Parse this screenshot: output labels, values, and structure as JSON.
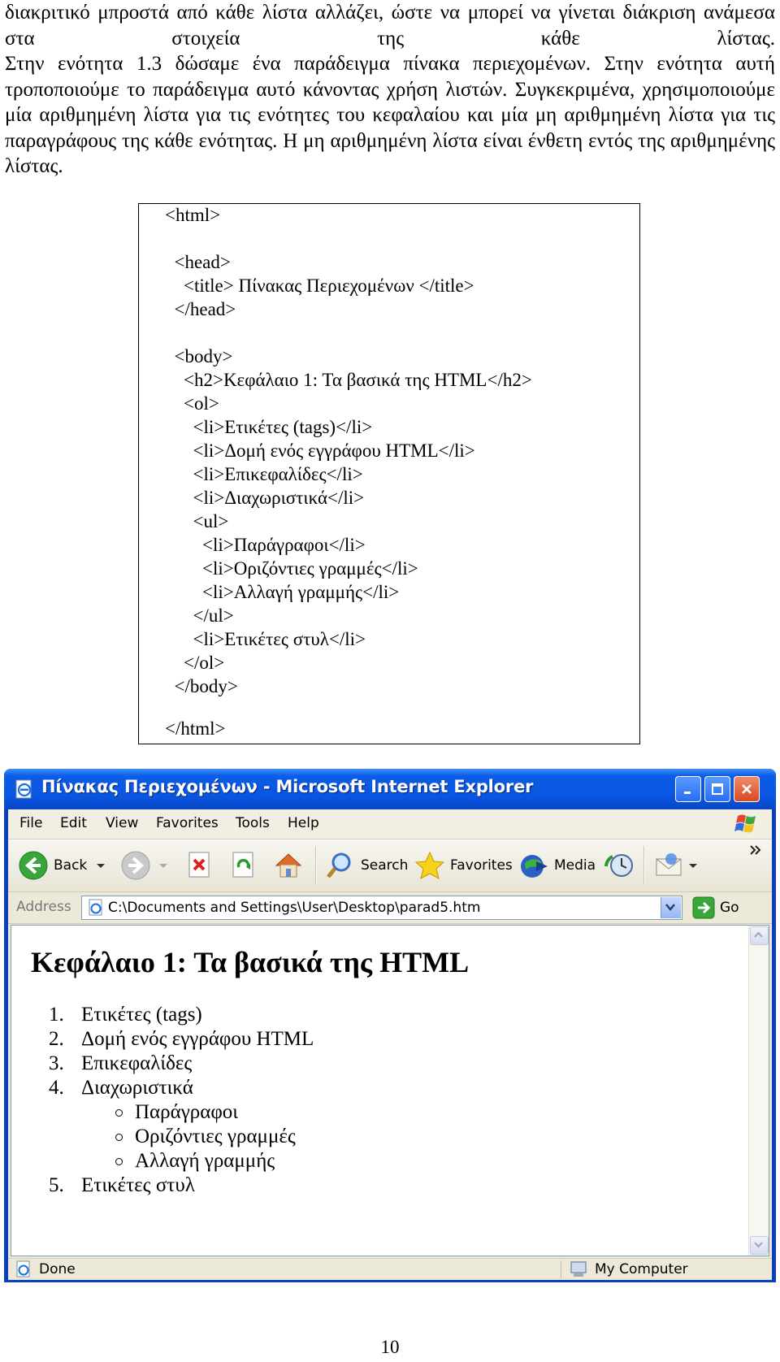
{
  "intro": {
    "line1": "διακριτικό μπροστά από κάθε λίστα αλλάζει, ώστε να μπορεί να γίνεται διάκριση ανάμεσα στα στοιχεία της κάθε λίστας.",
    "para2": "Στην ενότητα 1.3 δώσαμε ένα παράδειγμα πίνακα περιεχομένων. Στην ενότητα αυτή τροποποιούμε το παράδειγμα αυτό κάνοντας χρήση λιστών. Συγκεκριμένα, χρησιμοποιούμε μία αριθμημένη λίστα για τις ενότητες του κεφαλαίου και μία μη αριθμημένη λίστα για τις παραγράφους της κάθε ενότητας. Η μη αριθμημένη λίστα είναι ένθετη εντός της αριθμημένης λίστας."
  },
  "code": [
    "<html>",
    "",
    "  <head>",
    "    <title> Πίνακας Περιεχομένων </title>",
    "  </head>",
    "",
    "  <body>",
    "    <h2>Κεφάλαιο 1: Τα βασικά της HTML</h2>",
    "    <ol>",
    "      <li>Ετικέτες (tags)</li>",
    "      <li>Δομή ενός εγγράφου HTML</li>",
    "      <li>Επικεφαλίδες</li>",
    "      <li>Διαχωριστικά</li>",
    "      <ul>",
    "        <li>Παράγραφοι</li>",
    "        <li>Οριζόντιες γραμμές</li>",
    "        <li>Αλλαγή γραμμής</li>",
    "      </ul>",
    "      <li>Ετικέτες στυλ</li>",
    "    </ol>",
    "  </body>",
    "",
    "</html>"
  ],
  "browser": {
    "title": "Πίνακας Περιεχομένων - Microsoft Internet Explorer",
    "menu": [
      "File",
      "Edit",
      "View",
      "Favorites",
      "Tools",
      "Help"
    ],
    "toolbar": {
      "back": "Back",
      "search": "Search",
      "favorites": "Favorites",
      "media": "Media"
    },
    "address_label": "Address",
    "address": "C:\\Documents and Settings\\User\\Desktop\\parad5.htm",
    "go": "Go",
    "status": "Done",
    "zone": "My Computer",
    "page": {
      "heading": "Κεφάλαιο 1: Τα βασικά της HTML",
      "ol": [
        {
          "num": "1.",
          "text": "Ετικέτες (tags)"
        },
        {
          "num": "2.",
          "text": "Δομή ενός εγγράφου HTML"
        },
        {
          "num": "3.",
          "text": "Επικεφαλίδες"
        },
        {
          "num": "4.",
          "text": "Διαχωριστικά"
        },
        {
          "num": "5.",
          "text": "Ετικέτες στυλ"
        }
      ],
      "ul": [
        "Παράγραφοι",
        "Οριζόντιες γραμμές",
        "Αλλαγή γραμμής"
      ]
    },
    "colors": {
      "titlebar": "#0a55e0",
      "frame": "#ece9d8"
    }
  },
  "page_number": "10"
}
